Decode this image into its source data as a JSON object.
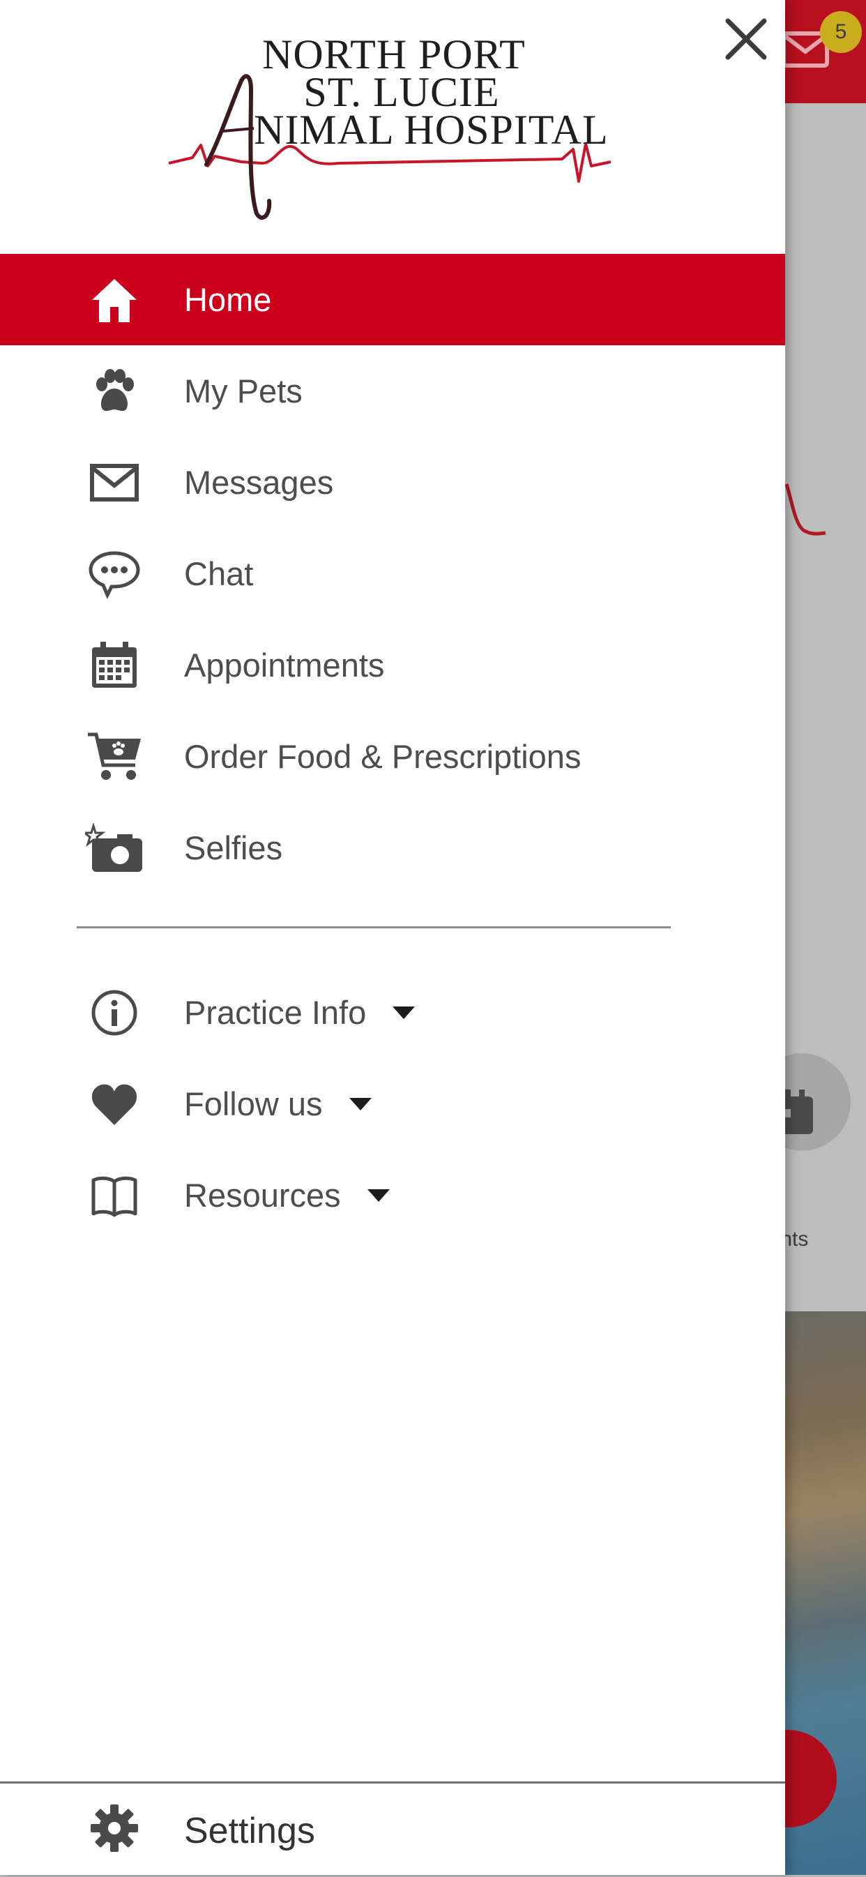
{
  "background": {
    "mail_badge_count": "5",
    "partial_label": "nents",
    "accent_color": "#cc001c"
  },
  "logo": {
    "line1": "NORTH PORT",
    "line2": "ST. LUCIE",
    "line3": "NIMAL HOSPITAL",
    "initial": "A"
  },
  "menu": {
    "items": [
      {
        "label": "Home",
        "icon": "home-icon",
        "active": true
      },
      {
        "label": "My Pets",
        "icon": "paw-icon"
      },
      {
        "label": "Messages",
        "icon": "envelope-icon"
      },
      {
        "label": "Chat",
        "icon": "chat-bubble-icon"
      },
      {
        "label": "Appointments",
        "icon": "calendar-icon"
      },
      {
        "label": "Order Food & Prescriptions",
        "icon": "cart-icon"
      },
      {
        "label": "Selfies",
        "icon": "camera-icon"
      }
    ],
    "secondary": [
      {
        "label": "Practice Info",
        "icon": "info-icon",
        "expandable": true
      },
      {
        "label": "Follow us",
        "icon": "heart-icon",
        "expandable": true
      },
      {
        "label": "Resources",
        "icon": "book-icon",
        "expandable": true
      }
    ]
  },
  "settings": {
    "label": "Settings",
    "icon": "gear-icon"
  }
}
